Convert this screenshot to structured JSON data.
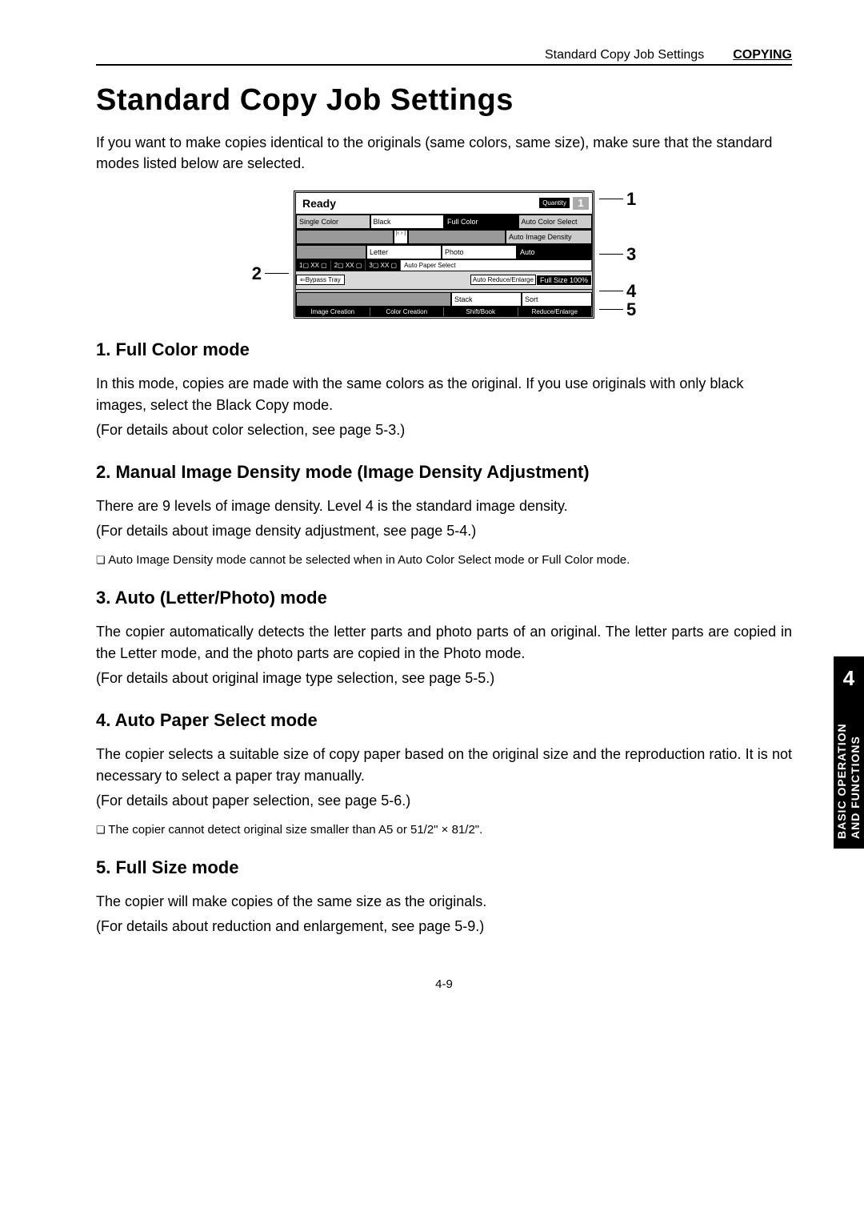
{
  "header": {
    "section": "Standard Copy Job Settings",
    "chapter": "COPYING"
  },
  "title": "Standard Copy Job Settings",
  "intro": "If you want to make copies identical to the originals (same colors, same size), make sure that the standard modes listed below are selected.",
  "panel": {
    "ready": "Ready",
    "quantity_label": "Quantity",
    "quantity_value": "1",
    "row_colors": [
      "Single Color",
      "Black",
      "Full Color",
      "Auto Color Select"
    ],
    "density_slider": "|‹ › |",
    "auto_img_density": "Auto Image Density",
    "row_type": [
      "",
      "Letter",
      "Photo",
      "Auto"
    ],
    "trays": [
      "1▢ XX ▢",
      "2▢ XX ▢",
      "3▢ XX ▢",
      "Auto Paper Select"
    ],
    "bypass": "⇐Bypass Tray",
    "auto_re": "Auto Reduce/Enlarge",
    "full_size": "Full Size 100%",
    "stack": "Stack",
    "sort": "Sort",
    "tabs": [
      "Image Creation",
      "Color Creation",
      "Shift/Book",
      "Reduce/Enlarge"
    ]
  },
  "callouts": {
    "c1": "1",
    "c2": "2",
    "c3": "3",
    "c4": "4",
    "c5": "5"
  },
  "sections": {
    "s1": {
      "heading": "1. Full Color mode",
      "p1": "In this mode, copies are made with the same colors as the original.  If you use originals with only black images, select the Black Copy mode.",
      "p2": "(For details about color selection, see page 5-3.)"
    },
    "s2": {
      "heading": "2. Manual Image Density mode (Image Density Adjustment)",
      "p1": "There are 9 levels of image density.  Level 4 is the standard image density.",
      "p2": "(For details about image density adjustment, see page 5-4.)",
      "note": "Auto Image Density mode cannot be selected when in Auto Color Select mode or Full Color mode."
    },
    "s3": {
      "heading": "3. Auto (Letter/Photo) mode",
      "p1": "The copier automatically detects the letter parts and photo parts of an original.  The letter parts are copied in the Letter mode, and the photo parts are copied in the Photo mode.",
      "p2": "(For details about original image type selection, see page 5-5.)"
    },
    "s4": {
      "heading": "4. Auto Paper Select mode",
      "p1": "The copier selects a suitable size of copy paper based on the original size and the reproduction ratio.  It is not necessary to select a paper tray manually.",
      "p2": "(For details about paper selection, see page 5-6.)",
      "note": "The copier cannot detect original size smaller than A5 or 51/2\" × 81/2\"."
    },
    "s5": {
      "heading": "5. Full Size mode",
      "p1": "The copier will make copies of the same size as the originals.",
      "p2": "(For details about reduction and enlargement, see page 5-9.)"
    }
  },
  "side": {
    "num": "4",
    "text": "BASIC OPERATION AND FUNCTIONS"
  },
  "footer": "4-9"
}
